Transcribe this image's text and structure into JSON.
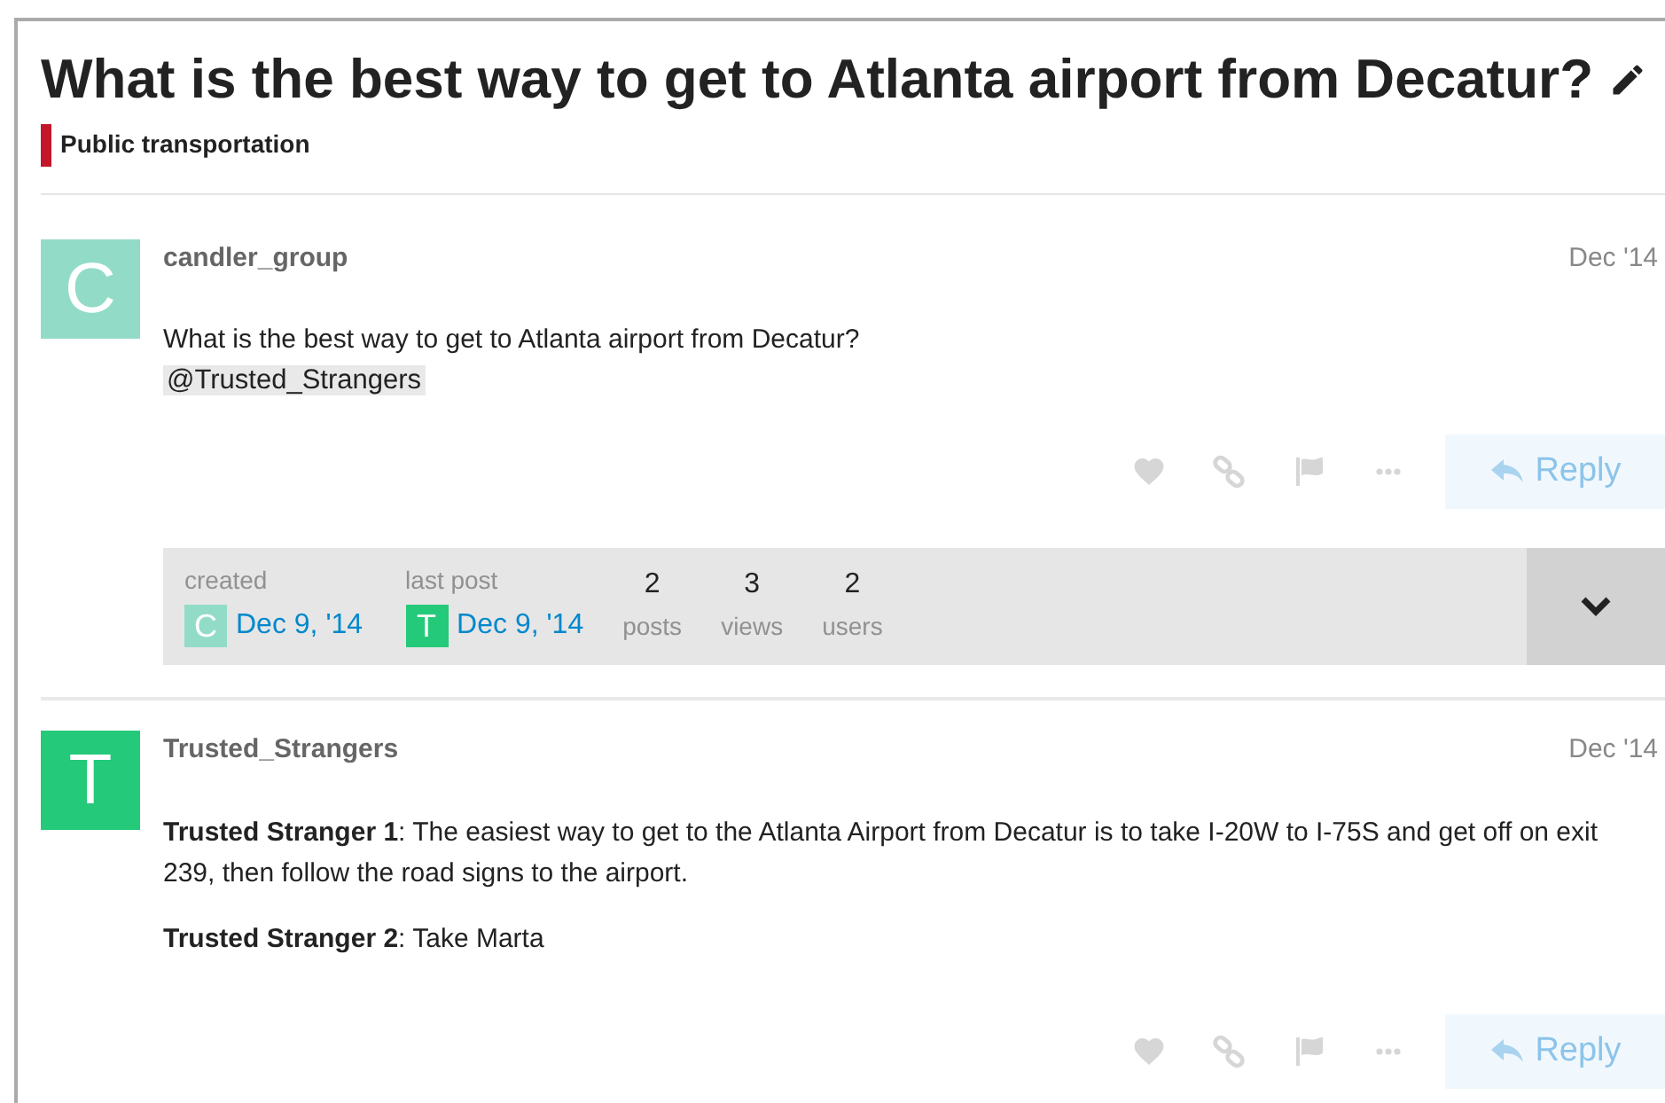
{
  "topic": {
    "title": "What is the best way to get to Atlanta airport from Decatur?",
    "category": {
      "name": "Public transportation",
      "color": "#c4162a"
    }
  },
  "posts": [
    {
      "avatar": {
        "letter": "C",
        "color": "#92dcc7"
      },
      "username": "candler_group",
      "date": "Dec '14",
      "body": [
        {
          "kind": "text",
          "text": "What is the best way to get to Atlanta airport from Decatur?"
        },
        {
          "kind": "mention",
          "text": "@Trusted_Strangers"
        }
      ],
      "reply_label": "Reply",
      "topic_map": {
        "people": [
          {
            "label": "created",
            "avatar": {
              "letter": "C",
              "color": "#92dcc7"
            },
            "date": "Dec 9, '14"
          },
          {
            "label": "last post",
            "avatar": {
              "letter": "T",
              "color": "#25c97a"
            },
            "date": "Dec 9, '14"
          }
        ],
        "stats": [
          {
            "value": "2",
            "label": "posts"
          },
          {
            "value": "3",
            "label": "views"
          },
          {
            "value": "2",
            "label": "users"
          }
        ]
      }
    },
    {
      "avatar": {
        "letter": "T",
        "color": "#25c97a"
      },
      "username": "Trusted_Strangers",
      "date": "Dec '14",
      "body": [
        {
          "kind": "text",
          "text": "**Trusted Stranger 1**: The easiest way to get to the Atlanta Airport from Decatur is to take I-20W to I-75S and get off on exit 239, then follow the road signs to the airport."
        },
        {
          "kind": "text",
          "text": "**Trusted Stranger 2**: Take Marta"
        }
      ],
      "reply_label": "Reply"
    }
  ]
}
